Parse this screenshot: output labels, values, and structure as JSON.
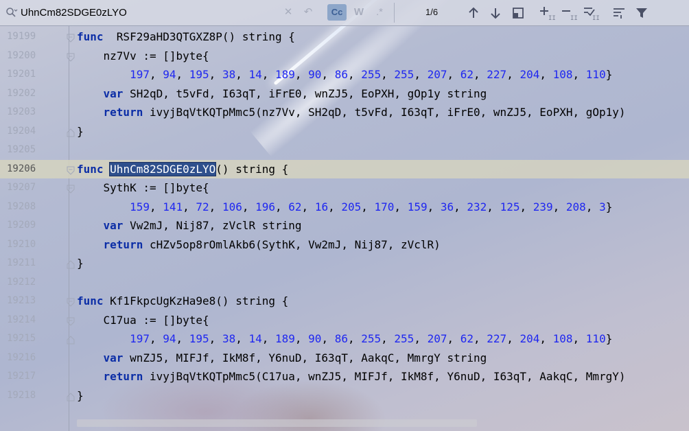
{
  "find": {
    "query": "UhnCm82SDGE0zLYO",
    "case_toggle": "Cc",
    "words_toggle": "W",
    "regex_toggle": ".*",
    "match_count": "1/6"
  },
  "icons": [
    "search-icon",
    "clear-icon",
    "history-icon",
    "match-case-icon",
    "words-icon",
    "regex-icon",
    "prev-occurrence-icon",
    "next-occurrence-icon",
    "select-all-icon",
    "add-selection-icon",
    "remove-selection-icon",
    "select-all-occurrences-icon",
    "multiline-icon",
    "filter-icon"
  ],
  "editor": {
    "lines": [
      {
        "num": "19199",
        "fold": "minus",
        "tokens": [
          [
            "kw",
            "func"
          ],
          [
            "",
            "  RSF29aHD3QTGXZ8P() string {"
          ]
        ]
      },
      {
        "num": "19200",
        "fold": "minus",
        "tokens": [
          [
            "",
            "    nz7Vv := []byte{"
          ]
        ]
      },
      {
        "num": "19201",
        "fold": "",
        "tokens": [
          [
            "",
            "        "
          ],
          [
            "num",
            "197"
          ],
          [
            "",
            ", "
          ],
          [
            "num",
            "94"
          ],
          [
            "",
            ", "
          ],
          [
            "num",
            "195"
          ],
          [
            "",
            ", "
          ],
          [
            "num",
            "38"
          ],
          [
            "",
            ", "
          ],
          [
            "num",
            "14"
          ],
          [
            "",
            ", "
          ],
          [
            "num",
            "189"
          ],
          [
            "",
            ", "
          ],
          [
            "num",
            "90"
          ],
          [
            "",
            ", "
          ],
          [
            "num",
            "86"
          ],
          [
            "",
            ", "
          ],
          [
            "num",
            "255"
          ],
          [
            "",
            ", "
          ],
          [
            "num",
            "255"
          ],
          [
            "",
            ", "
          ],
          [
            "num",
            "207"
          ],
          [
            "",
            ", "
          ],
          [
            "num",
            "62"
          ],
          [
            "",
            ", "
          ],
          [
            "num",
            "227"
          ],
          [
            "",
            ", "
          ],
          [
            "num",
            "204"
          ],
          [
            "",
            ", "
          ],
          [
            "num",
            "108"
          ],
          [
            "",
            ", "
          ],
          [
            "num",
            "110"
          ],
          [
            "",
            "}"
          ]
        ]
      },
      {
        "num": "19202",
        "fold": "",
        "tokens": [
          [
            "",
            "    "
          ],
          [
            "kw",
            "var"
          ],
          [
            "",
            " SH2qD, t5vFd, I63qT, iFrE0, wnZJ5, EoPXH, gOp1y string"
          ]
        ]
      },
      {
        "num": "19203",
        "fold": "",
        "tokens": [
          [
            "",
            "    "
          ],
          [
            "kw",
            "return"
          ],
          [
            "",
            " ivyjBqVtKQTpMmc5(nz7Vv, SH2qD, t5vFd, I63qT, iFrE0, wnZJ5, EoPXH, gOp1y)"
          ]
        ]
      },
      {
        "num": "19204",
        "fold": "end",
        "tokens": [
          [
            "",
            "}"
          ]
        ]
      },
      {
        "num": "19205",
        "fold": "",
        "tokens": []
      },
      {
        "num": "19206",
        "fold": "minus",
        "current": true,
        "tokens": [
          [
            "kw",
            "func"
          ],
          [
            "",
            " "
          ],
          [
            "sel",
            "UhnCm82SDGE0zLYO"
          ],
          [
            "",
            "() string {"
          ]
        ]
      },
      {
        "num": "19207",
        "fold": "minus",
        "tokens": [
          [
            "",
            "    SythK := []byte{"
          ]
        ]
      },
      {
        "num": "19208",
        "fold": "",
        "tokens": [
          [
            "",
            "        "
          ],
          [
            "num",
            "159"
          ],
          [
            "",
            ", "
          ],
          [
            "num",
            "141"
          ],
          [
            "",
            ", "
          ],
          [
            "num",
            "72"
          ],
          [
            "",
            ", "
          ],
          [
            "num",
            "106"
          ],
          [
            "",
            ", "
          ],
          [
            "num",
            "196"
          ],
          [
            "",
            ", "
          ],
          [
            "num",
            "62"
          ],
          [
            "",
            ", "
          ],
          [
            "num",
            "16"
          ],
          [
            "",
            ", "
          ],
          [
            "num",
            "205"
          ],
          [
            "",
            ", "
          ],
          [
            "num",
            "170"
          ],
          [
            "",
            ", "
          ],
          [
            "num",
            "159"
          ],
          [
            "",
            ", "
          ],
          [
            "num",
            "36"
          ],
          [
            "",
            ", "
          ],
          [
            "num",
            "232"
          ],
          [
            "",
            ", "
          ],
          [
            "num",
            "125"
          ],
          [
            "",
            ", "
          ],
          [
            "num",
            "239"
          ],
          [
            "",
            ", "
          ],
          [
            "num",
            "208"
          ],
          [
            "",
            ", "
          ],
          [
            "num",
            "3"
          ],
          [
            "",
            "}"
          ]
        ]
      },
      {
        "num": "19209",
        "fold": "",
        "tokens": [
          [
            "",
            "    "
          ],
          [
            "kw",
            "var"
          ],
          [
            "",
            " Vw2mJ, Nij87, zVclR string"
          ]
        ]
      },
      {
        "num": "19210",
        "fold": "",
        "tokens": [
          [
            "",
            "    "
          ],
          [
            "kw",
            "return"
          ],
          [
            "",
            " cHZv5op8rOmlAkb6(SythK, Vw2mJ, Nij87, zVclR)"
          ]
        ]
      },
      {
        "num": "19211",
        "fold": "end",
        "tokens": [
          [
            "",
            "}"
          ]
        ]
      },
      {
        "num": "19212",
        "fold": "",
        "tokens": []
      },
      {
        "num": "19213",
        "fold": "minus",
        "tokens": [
          [
            "kw",
            "func"
          ],
          [
            "",
            " Kf1FkpcUgKzHa9e8() string {"
          ]
        ]
      },
      {
        "num": "19214",
        "fold": "minus",
        "tokens": [
          [
            "",
            "    C17ua := []byte{"
          ]
        ]
      },
      {
        "num": "19215",
        "fold": "end",
        "tokens": [
          [
            "",
            "        "
          ],
          [
            "num",
            "197"
          ],
          [
            "",
            ", "
          ],
          [
            "num",
            "94"
          ],
          [
            "",
            ", "
          ],
          [
            "num",
            "195"
          ],
          [
            "",
            ", "
          ],
          [
            "num",
            "38"
          ],
          [
            "",
            ", "
          ],
          [
            "num",
            "14"
          ],
          [
            "",
            ", "
          ],
          [
            "num",
            "189"
          ],
          [
            "",
            ", "
          ],
          [
            "num",
            "90"
          ],
          [
            "",
            ", "
          ],
          [
            "num",
            "86"
          ],
          [
            "",
            ", "
          ],
          [
            "num",
            "255"
          ],
          [
            "",
            ", "
          ],
          [
            "num",
            "255"
          ],
          [
            "",
            ", "
          ],
          [
            "num",
            "207"
          ],
          [
            "",
            ", "
          ],
          [
            "num",
            "62"
          ],
          [
            "",
            ", "
          ],
          [
            "num",
            "227"
          ],
          [
            "",
            ", "
          ],
          [
            "num",
            "204"
          ],
          [
            "",
            ", "
          ],
          [
            "num",
            "108"
          ],
          [
            "",
            ", "
          ],
          [
            "num",
            "110"
          ],
          [
            "",
            "}"
          ]
        ]
      },
      {
        "num": "19216",
        "fold": "",
        "tokens": [
          [
            "",
            "    "
          ],
          [
            "kw",
            "var"
          ],
          [
            "",
            " wnZJ5, MIFJf, IkM8f, Y6nuD, I63qT, AakqC, MmrgY string"
          ]
        ]
      },
      {
        "num": "19217",
        "fold": "",
        "tokens": [
          [
            "",
            "    "
          ],
          [
            "kw",
            "return"
          ],
          [
            "",
            " ivyjBqVtKQTpMmc5(C17ua, wnZJ5, MIFJf, IkM8f, Y6nuD, I63qT, AakqC, MmrgY)"
          ]
        ]
      },
      {
        "num": "19218",
        "fold": "end",
        "tokens": [
          [
            "",
            "}"
          ]
        ]
      },
      {
        "num": "",
        "fold": "",
        "tokens": []
      }
    ]
  }
}
